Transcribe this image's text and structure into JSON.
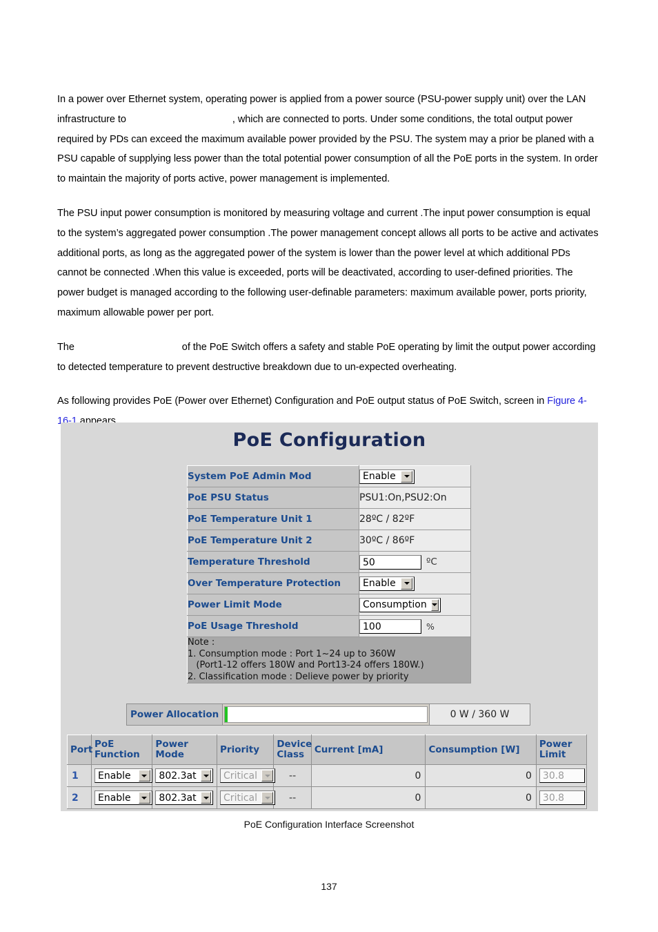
{
  "document": {
    "paragraphs": [
      "In a power over Ethernet system, operating power is applied from a power source (PSU-power supply unit) over the LAN infrastructure to ",
      ", which are connected to ports. Under some conditions, the total output power required by PDs can exceed the maximum available power provided by the PSU. The system may a prior be planed with a PSU capable of supplying less power than the total potential power consumption of all the PoE ports in the system. In order to maintain the majority of ports active, power management is implemented.",
      "The PSU input power consumption is monitored by measuring voltage and current .The input power consumption is equal to the system’s aggregated power consumption .The power management concept allows all ports to be active and activates additional ports, as long as the aggregated power of the system is lower than the power level at which additional PDs cannot be connected .When this value is exceeded, ports will be deactivated, according to user-defined priorities. The power budget is managed according to the following user-definable parameters: maximum available power, ports priority, maximum allowable power per port.",
      "The ",
      " of the PoE Switch offers a safety and stable PoE operating by limit the output power according to detected temperature to prevent destructive breakdown due to un-expected overheating.",
      "As following provides PoE (Power over Ethernet) Configuration and PoE output status of PoE Switch, screen in ",
      " appears."
    ],
    "xref_link": "Figure 4-16-1",
    "caption": "PoE Configuration Interface Screenshot",
    "page_number": "137"
  },
  "screenshot": {
    "title": "PoE Configuration",
    "settings": [
      {
        "label": "System PoE Admin Mod",
        "control": "select",
        "value": "Enable",
        "unit": ""
      },
      {
        "label": "PoE PSU Status",
        "control": "text",
        "value": "PSU1:On,PSU2:On",
        "unit": ""
      },
      {
        "label": "PoE Temperature Unit 1",
        "control": "text",
        "value": "28ºC / 82ºF",
        "unit": ""
      },
      {
        "label": "PoE Temperature Unit 2",
        "control": "text",
        "value": "30ºC / 86ºF",
        "unit": ""
      },
      {
        "label": "Temperature Threshold",
        "control": "input",
        "value": "50",
        "unit": "ºC"
      },
      {
        "label": "Over Temperature Protection",
        "control": "select",
        "value": "Enable",
        "unit": ""
      },
      {
        "label": "Power Limit Mode",
        "control": "select",
        "value": "Consumption",
        "unit": ""
      },
      {
        "label": "PoE Usage Threshold",
        "control": "input",
        "value": "100",
        "unit": "%"
      }
    ],
    "note": "Note :\n1. Consumption mode : Port 1~24 up to 360W\n   (Port1-12 offers 180W and Port13-24 offers 180W.)\n2. Classification mode : Delieve power by priority",
    "power_allocation": {
      "label": "Power Allocation",
      "value": "0 W / 360 W",
      "used_watts": 0,
      "total_watts": 360,
      "fill_percent": 0,
      "fill_color": "#22c422"
    },
    "port_table": {
      "headers": [
        "Port",
        "PoE Function",
        "Power Mode",
        "Priority",
        "Device Class",
        "Current [mA]",
        "Consumption [W]",
        "Power Limit"
      ],
      "rows": [
        {
          "port": "1",
          "poe_function": "Enable",
          "power_mode": "802.3at",
          "priority": "Critical",
          "device_class": "--",
          "current_ma": "0",
          "consumption_w": "0",
          "power_limit": "30.8"
        },
        {
          "port": "2",
          "poe_function": "Enable",
          "power_mode": "802.3at",
          "priority": "Critical",
          "device_class": "--",
          "current_ma": "0",
          "consumption_w": "0",
          "power_limit": "30.8"
        }
      ]
    },
    "colors": {
      "title": "#1b2a57",
      "label_text": "#1b4b8f",
      "panel_bg": "#d8d8d8",
      "header_bg": "#c6c6c6",
      "link": "#2222dd"
    }
  }
}
